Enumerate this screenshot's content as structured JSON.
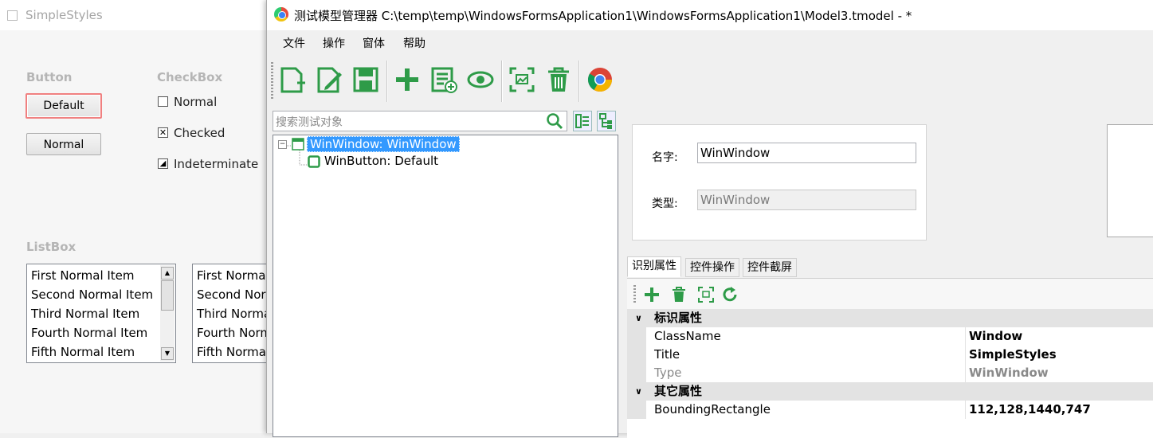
{
  "bg_window": {
    "title": "SimpleStyles",
    "button_group": {
      "header": "Button",
      "default_label": "Default",
      "normal_label": "Normal"
    },
    "checkbox_group": {
      "header": "CheckBox",
      "items": [
        {
          "label": "Normal",
          "state": "unchecked",
          "mark": ""
        },
        {
          "label": "Checked",
          "state": "checked",
          "mark": "✕"
        },
        {
          "label": "Indeterminate",
          "state": "indeterminate",
          "mark": "◢"
        }
      ]
    },
    "listbox_group": {
      "header": "ListBox",
      "items": [
        "First Normal Item",
        "Second Normal Item",
        "Third Normal Item",
        "Fourth Normal Item",
        "Fifth Normal Item"
      ],
      "items_clipped": [
        "First Norma",
        "Second Nor",
        "Third Norma",
        "Fourth Norm",
        "Fifth Norma"
      ]
    }
  },
  "main_window": {
    "title": "测试模型管理器 C:\\temp\\temp\\WindowsFormsApplication1\\WindowsFormsApplication1\\Model3.tmodel - *",
    "menu": [
      "文件",
      "操作",
      "窗体",
      "帮助"
    ],
    "toolbar_icons": [
      "new-model-icon",
      "edit-model-icon",
      "save-icon",
      "add-icon",
      "add-list-icon",
      "view-icon",
      "capture-icon",
      "delete-icon",
      "chrome-icon"
    ],
    "search": {
      "placeholder": "搜索测试对象"
    },
    "tree": [
      {
        "label": "WinWindow: WinWindow",
        "selected": true,
        "expander": "−"
      },
      {
        "label": "WinButton: Default",
        "selected": false
      }
    ],
    "props": {
      "name_label": "名字:",
      "name_value": "WinWindow",
      "type_label": "类型:",
      "type_value": "WinWindow"
    },
    "tabs": [
      "识别属性",
      "控件操作",
      "控件截屏"
    ],
    "active_tab": 0,
    "grid": {
      "cat1": "标识属性",
      "cat1_rows": [
        {
          "key": "ClassName",
          "value": "Window"
        },
        {
          "key": "Title",
          "value": "SimpleStyles"
        },
        {
          "key": "Type",
          "value": "WinWindow"
        }
      ],
      "cat2": "其它属性",
      "cat2_rows": [
        {
          "key": "BoundingRectangle",
          "value": "112,128,1440,747"
        }
      ],
      "chevron": "∨"
    },
    "colors": {
      "accent_green": "#2e9b48",
      "selection_blue": "#3399ff"
    }
  }
}
